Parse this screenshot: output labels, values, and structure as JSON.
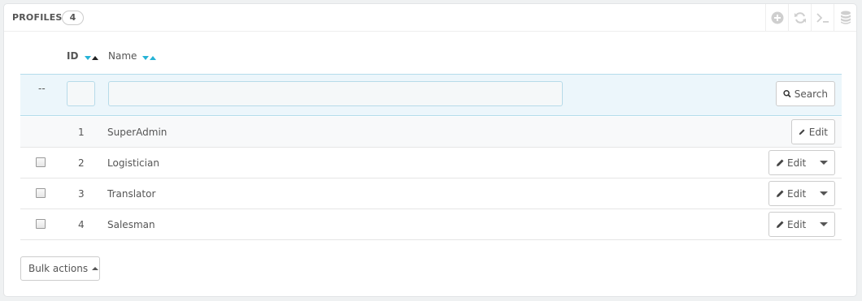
{
  "panel": {
    "title": "PROFILES",
    "count": "4",
    "toolbar": [
      {
        "icon": "add-icon"
      },
      {
        "icon": "refresh-icon"
      },
      {
        "icon": "sql-query-icon"
      },
      {
        "icon": "export-database-icon"
      }
    ]
  },
  "table": {
    "columns": {
      "id": "ID",
      "name": "Name"
    },
    "filter": {
      "checkbox_placeholder": "--",
      "id_value": "",
      "name_value": "",
      "search_label": "Search"
    },
    "rows": [
      {
        "id": "1",
        "name": "SuperAdmin",
        "action": "Edit",
        "has_checkbox": false,
        "has_dropdown": false
      },
      {
        "id": "2",
        "name": "Logistician",
        "action": "Edit",
        "has_checkbox": true,
        "has_dropdown": true
      },
      {
        "id": "3",
        "name": "Translator",
        "action": "Edit",
        "has_checkbox": true,
        "has_dropdown": true
      },
      {
        "id": "4",
        "name": "Salesman",
        "action": "Edit",
        "has_checkbox": true,
        "has_dropdown": true
      }
    ]
  },
  "bulk_actions_label": "Bulk actions",
  "colors": {
    "accent": "#26b3d6",
    "filter_bg": "#ecf6fb",
    "filter_border": "#b4dceb"
  }
}
